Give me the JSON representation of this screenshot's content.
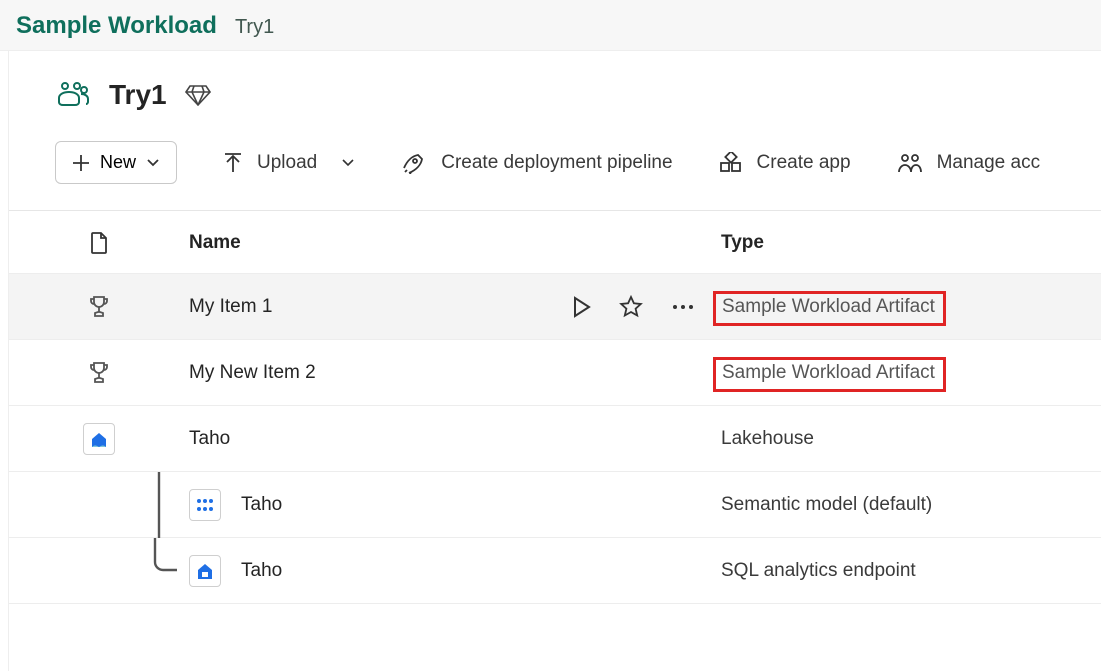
{
  "breadcrumb": {
    "root": "Sample Workload",
    "leaf": "Try1"
  },
  "workspace": {
    "name": "Try1"
  },
  "toolbar": {
    "new_label": "New",
    "upload_label": "Upload",
    "pipeline_label": "Create deployment pipeline",
    "create_app_label": "Create app",
    "manage_access_label": "Manage acc"
  },
  "columns": {
    "name": "Name",
    "type": "Type"
  },
  "rows": [
    {
      "name": "My Item 1",
      "type": "Sample Workload Artifact",
      "highlighted": true,
      "hovered": true,
      "kind": "trophy"
    },
    {
      "name": "My New Item 2",
      "type": "Sample Workload Artifact",
      "highlighted": true,
      "hovered": false,
      "kind": "trophy"
    },
    {
      "name": "Taho",
      "type": "Lakehouse",
      "highlighted": false,
      "hovered": false,
      "kind": "lakehouse"
    },
    {
      "name": "Taho",
      "type": "Semantic model (default)",
      "highlighted": false,
      "hovered": false,
      "kind": "semantic",
      "child": true,
      "treeFirst": true
    },
    {
      "name": "Taho",
      "type": "SQL analytics endpoint",
      "highlighted": false,
      "hovered": false,
      "kind": "endpoint",
      "child": true,
      "treeLast": true
    }
  ]
}
